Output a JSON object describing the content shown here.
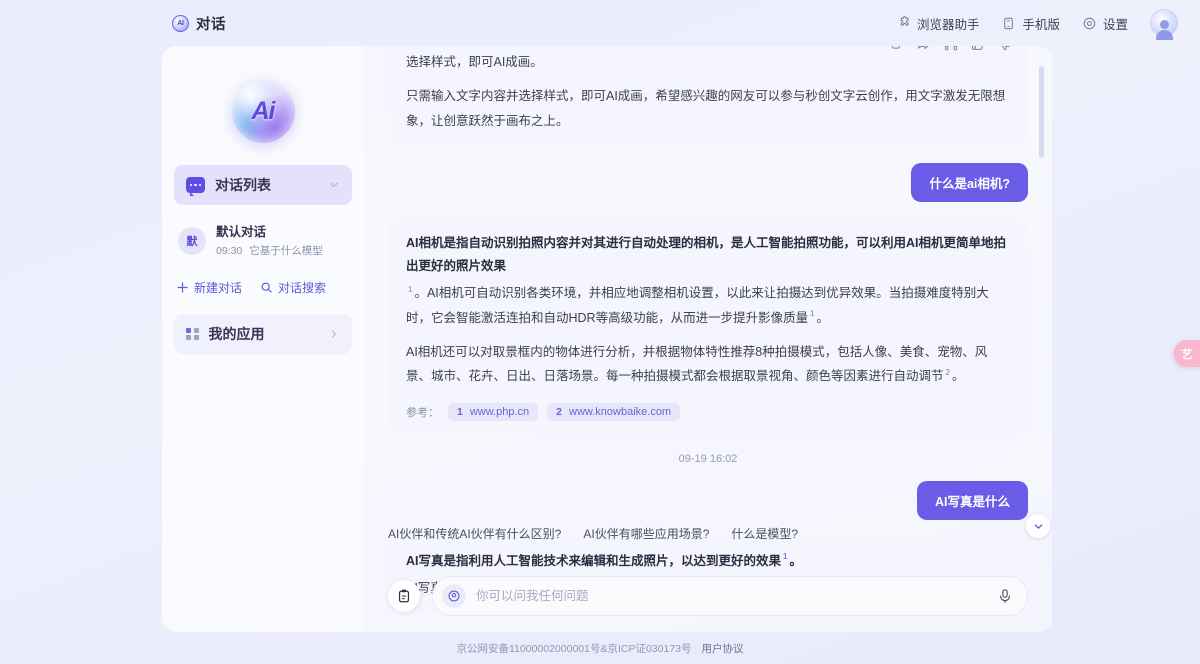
{
  "header": {
    "brand_mark": "AI",
    "title": "对话",
    "items": [
      {
        "label": "浏览器助手",
        "icon": "puzzle-icon"
      },
      {
        "label": "手机版",
        "icon": "phone-icon"
      },
      {
        "label": "设置",
        "icon": "gear-icon"
      }
    ],
    "avatar_alt": "用户头像"
  },
  "sidebar": {
    "logo_text": "Ai",
    "nav_primary": {
      "label": "对话列表",
      "icon": "chat-list-icon",
      "chevron": "chevron-down-icon"
    },
    "conversation": {
      "badge": "默",
      "title": "默认对话",
      "time": "09:30",
      "preview": "它基于什么模型"
    },
    "actions": [
      {
        "label": "新建对话",
        "icon": "plus-icon"
      },
      {
        "label": "对话搜索",
        "icon": "search-icon"
      }
    ],
    "nav_secondary": {
      "label": "我的应用",
      "icon": "grid-icon",
      "chevron": "chevron-right-icon"
    }
  },
  "chat": {
    "message_tools": [
      "copy-icon",
      "share-icon",
      "listen-icon",
      "thumbs-up-icon",
      "thumbs-down-icon"
    ],
    "msg1": {
      "line1": "选择样式，即可AI成画。",
      "line2": "只需输入文字内容并选择样式，即可AI成画，希望感兴趣的网友可以参与秒创文字云创作，用文字激发无限想象，让创意跃然于画布之上。"
    },
    "user_q1": "什么是ai相机?",
    "msg2": {
      "lead": "AI相机是指自动识别拍照内容并对其进行自动处理的相机，是人工智能拍照功能，可以利用AI相机更简单地拍出更好的照片效果",
      "sup1": "1",
      "para1_a": "。AI相机可自动识别各类环境，并相应地调整相机设置，以此来让拍摄达到优异效果。当拍摄难度特别大时，它会智能激活连拍和自动HDR等高级功能，从而进一步提升影像质量",
      "sup2": "1",
      "para1_b": "。",
      "para2": "AI相机还可以对取景框内的物体进行分析，并根据物体特性推荐8种拍摄模式，包括人像、美食、宠物、风景、城市、花卉、日出、日落场景。每一种拍摄模式都会根据取景视角、颜色等因素进行自动调节",
      "sup3": "2",
      "para2_end": "。",
      "refs_label": "参考：",
      "refs": [
        {
          "num": "1",
          "url": "www.php.cn"
        },
        {
          "num": "2",
          "url": "www.knowbaike.com"
        }
      ]
    },
    "timestamp": "09-19 16:02",
    "user_q2": "AI写真是什么",
    "msg3": {
      "lead": "AI写真是指利用人工智能技术来编辑和生成照片，以达到更好的效果",
      "sup1": "1",
      "lead_end": "。",
      "para1": "AI写真技术使用深度学习和计算机视觉算法，能够识别图像中的对象、场景和色彩，然后进行智能化的调整",
      "expand_icon": "chevron-down-icon"
    },
    "suggestions": [
      "AI伙伴和传统AI伙伴有什么区别?",
      "AI伙伴有哪些应用场景?",
      "什么是模型?"
    ],
    "composer": {
      "attach_icon": "clipboard-icon",
      "model_icon": "model-badge-icon",
      "placeholder": "你可以问我任何问题",
      "value": "",
      "mic_icon": "microphone-icon"
    }
  },
  "float_button": {
    "label": "艺",
    "icon": "art-icon"
  },
  "footer": {
    "text": "京公网安备11000002000001号&京ICP证030173号",
    "link": "用户协议"
  },
  "colors": {
    "accent": "#6b5ce8",
    "page_bg": "#e9ecfb",
    "panel_bg": "#ffffff",
    "ai_bubble": "#f4f5fd",
    "float_btn": "#f8b6cf"
  }
}
